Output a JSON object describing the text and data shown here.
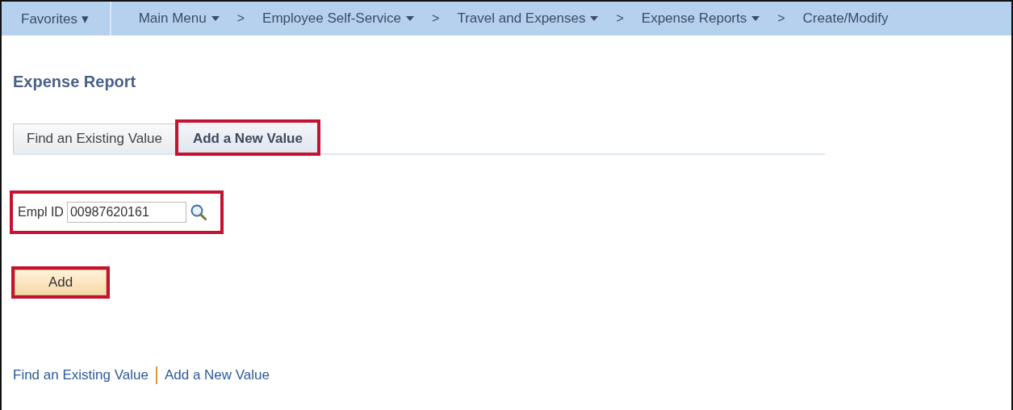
{
  "nav": {
    "favorites": "Favorites ▾",
    "crumbs": [
      {
        "label": "Main Menu",
        "dropdown": true
      },
      {
        "label": "Employee Self-Service",
        "dropdown": true
      },
      {
        "label": "Travel and Expenses",
        "dropdown": true
      },
      {
        "label": "Expense Reports",
        "dropdown": true
      },
      {
        "label": "Create/Modify",
        "dropdown": false
      }
    ],
    "separator": ">"
  },
  "page_title": "Expense Report",
  "tabs": [
    {
      "label": "Find an Existing Value",
      "selected": false,
      "highlighted": false
    },
    {
      "label": "Add a New Value",
      "selected": true,
      "highlighted": true
    }
  ],
  "field": {
    "label": "Empl ID",
    "value": "00987620161",
    "highlighted": true
  },
  "add_button": {
    "label": "Add",
    "highlighted": true
  },
  "footer_links": [
    "Find an Existing Value",
    "Add a New Value"
  ]
}
